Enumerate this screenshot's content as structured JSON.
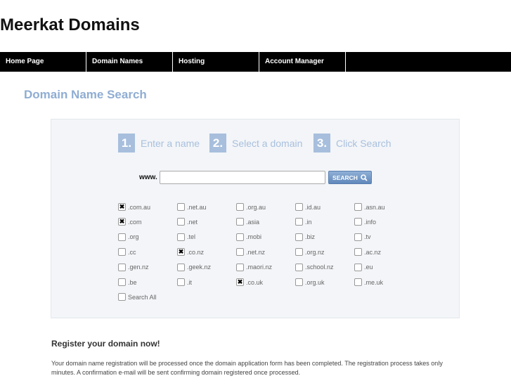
{
  "site_title": "Meerkat Domains",
  "nav": [
    "Home Page",
    "Domain Names",
    "Hosting",
    "Account Manager"
  ],
  "heading": "Domain Name Search",
  "steps": [
    {
      "num": "1.",
      "label": "Enter a name"
    },
    {
      "num": "2.",
      "label": "Select a domain"
    },
    {
      "num": "3.",
      "label": "Click Search"
    }
  ],
  "search": {
    "prefix": "www.",
    "value": "",
    "button": "SEARCH"
  },
  "domains": [
    {
      "label": ".com.au",
      "checked": true
    },
    {
      "label": ".net.au",
      "checked": false
    },
    {
      "label": ".org.au",
      "checked": false
    },
    {
      "label": ".id.au",
      "checked": false
    },
    {
      "label": ".asn.au",
      "checked": false
    },
    {
      "label": ".com",
      "checked": true
    },
    {
      "label": ".net",
      "checked": false
    },
    {
      "label": ".asia",
      "checked": false
    },
    {
      "label": ".in",
      "checked": false
    },
    {
      "label": ".info",
      "checked": false
    },
    {
      "label": ".org",
      "checked": false
    },
    {
      "label": ".tel",
      "checked": false
    },
    {
      "label": ".mobi",
      "checked": false
    },
    {
      "label": ".biz",
      "checked": false
    },
    {
      "label": ".tv",
      "checked": false
    },
    {
      "label": ".cc",
      "checked": false
    },
    {
      "label": ".co.nz",
      "checked": true
    },
    {
      "label": ".net.nz",
      "checked": false
    },
    {
      "label": ".org.nz",
      "checked": false
    },
    {
      "label": ".ac.nz",
      "checked": false
    },
    {
      "label": ".gen.nz",
      "checked": false
    },
    {
      "label": ".geek.nz",
      "checked": false
    },
    {
      "label": ".maori.nz",
      "checked": false
    },
    {
      "label": ".school.nz",
      "checked": false
    },
    {
      "label": ".eu",
      "checked": false
    },
    {
      "label": ".be",
      "checked": false
    },
    {
      "label": ".it",
      "checked": false
    },
    {
      "label": ".co.uk",
      "checked": true
    },
    {
      "label": ".org.uk",
      "checked": false
    },
    {
      "label": ".me.uk",
      "checked": false
    },
    {
      "label": "Search All",
      "checked": false
    }
  ],
  "register": {
    "title": "Register your domain now!",
    "text": "Your domain name registration will be processed once the domain application form has been completed. The registration process takes only minutes. A confirmation e-mail will be sent confirming domain registered once processed."
  }
}
